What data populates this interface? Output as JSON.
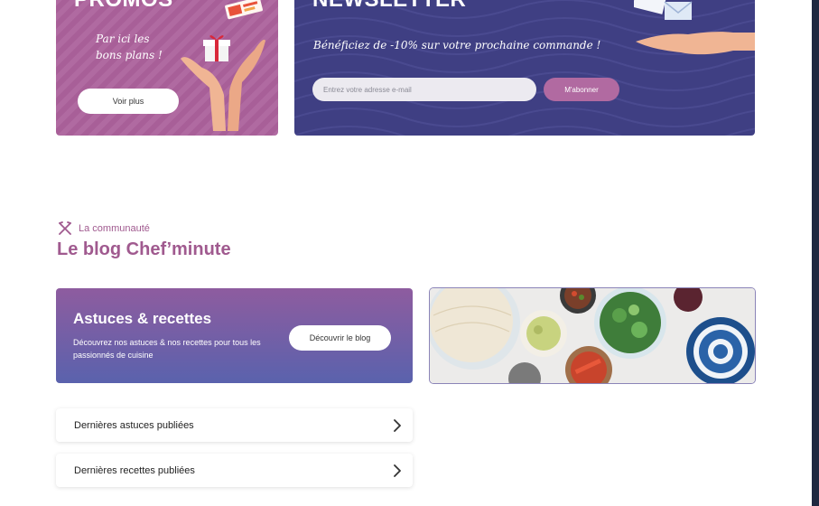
{
  "promo": {
    "title": "PROMOS",
    "subtitle_line1": "Par ici les",
    "subtitle_line2": "bons plans !",
    "button_label": "Voir plus"
  },
  "newsletter": {
    "title": "NEWSLETTER",
    "subtitle": "Bénéficiez de -10% sur votre prochaine commande !",
    "input_placeholder": "Entrez votre adresse e-mail",
    "button_label": "M'abonner"
  },
  "community": {
    "eyebrow": "La communauté",
    "title": "Le blog Chef’minute",
    "eyebrow_icon": "fork-knife-icon"
  },
  "astuces": {
    "title": "Astuces & recettes",
    "description": "Découvrez nos astuces & nos recettes pour tous les passionnés de cuisine",
    "button_label": "Découvrir le blog"
  },
  "list": [
    {
      "label": "Dernières astuces publiées"
    },
    {
      "label": "Dernières recettes publiées"
    }
  ],
  "colors": {
    "brand_pink": "#a85f98",
    "brand_navy": "#3f3f83",
    "accent_button": "#b16aa1"
  }
}
